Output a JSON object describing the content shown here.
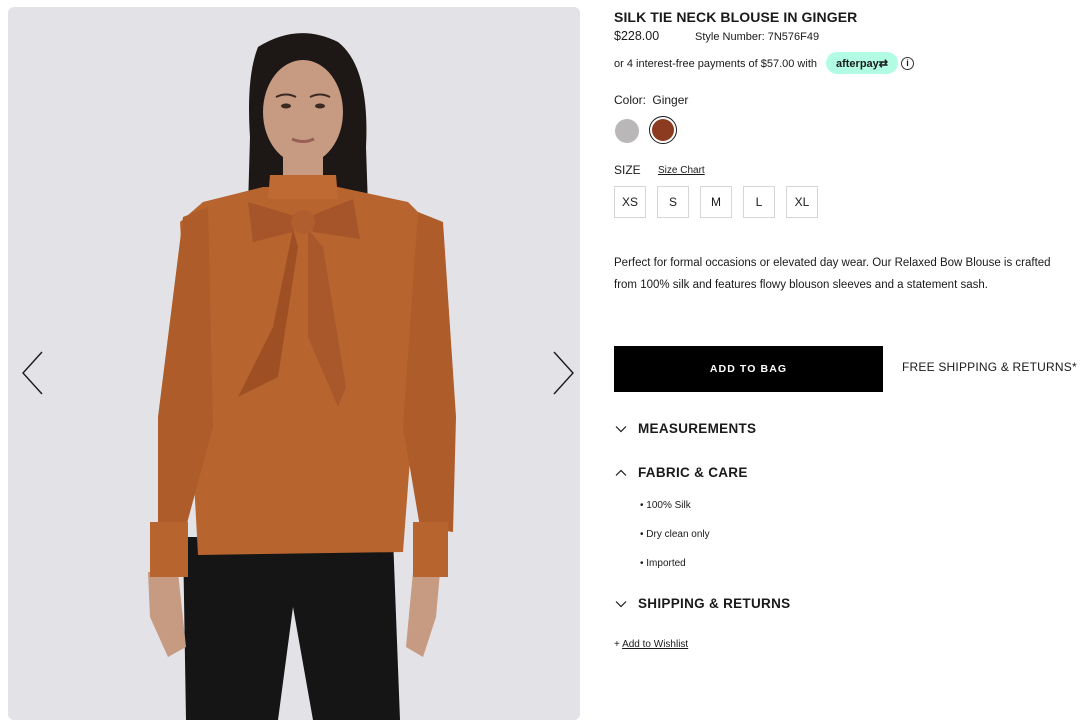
{
  "gallery": {
    "prev_icon": "chevron-left-icon",
    "next_icon": "chevron-right-icon",
    "colors": {
      "background": "#e3e2e6",
      "blouse": "#b8642f",
      "trousers": "#151515",
      "skin": "#c79a82",
      "hair": "#1d1816"
    }
  },
  "product": {
    "title": "SILK TIE NECK BLOUSE IN GINGER",
    "price": "$228.00",
    "style_number": "Style Number: 7N576F49",
    "installments": "or 4 interest-free payments of $57.00 with",
    "afterpay_label": "afterpay⇄",
    "info_icon": "i",
    "color_label": "Color:",
    "color_value": "Ginger",
    "swatches": [
      {
        "name": "Grey",
        "hex": "#bab7b8"
      },
      {
        "name": "Ginger",
        "hex": "#8c3a20",
        "selected": true
      }
    ],
    "size_label": "SIZE",
    "size_chart": "Size Chart",
    "sizes": [
      "XS",
      "S",
      "M",
      "L",
      "XL"
    ],
    "description": "Perfect for formal occasions or elevated day wear. Our Relaxed Bow Blouse is crafted from 100% silk and features flowy blouson sleeves and a statement sash.",
    "add_to_bag": "ADD TO BAG",
    "free_shipping": "FREE SHIPPING & RETURNS*"
  },
  "accordion": {
    "measurements": "MEASUREMENTS",
    "fabric_care": "FABRIC & CARE",
    "fabric_items": [
      "• 100% Silk",
      "• Dry clean only",
      "• Imported"
    ],
    "shipping_returns": "SHIPPING & RETURNS"
  },
  "wishlist": {
    "prefix": "+",
    "label": "Add to Wishlist"
  }
}
